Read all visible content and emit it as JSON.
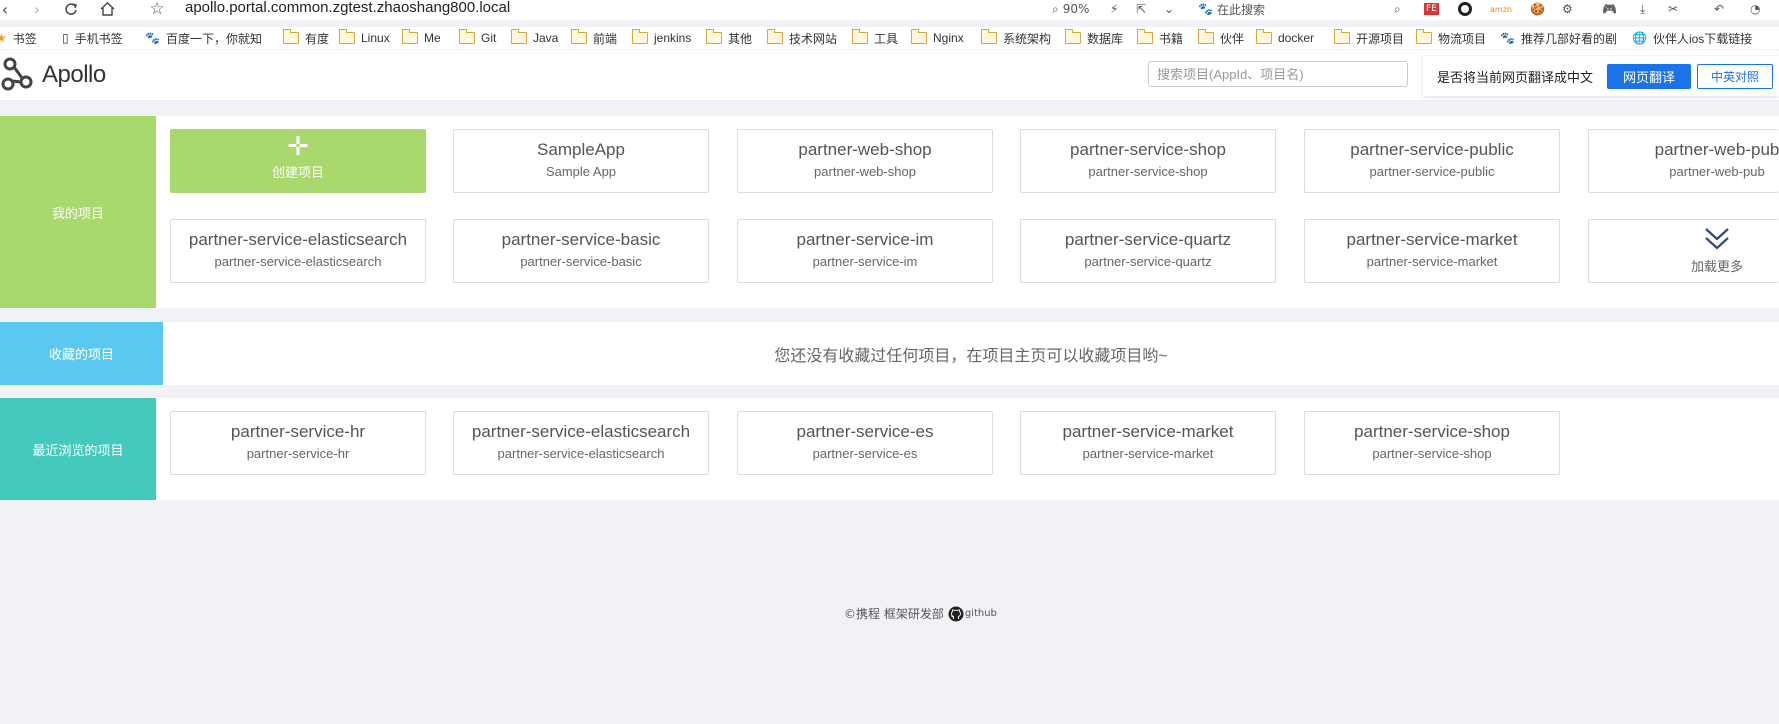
{
  "browser": {
    "url": "apollo.portal.common.zgtest.zhaoshang800.local",
    "zoom": "90%",
    "search_label": "在此搜索",
    "bookmarks": [
      {
        "label": "书签",
        "icon": "star-icon"
      },
      {
        "label": "手机书签",
        "icon": "phone-icon"
      },
      {
        "label": "百度一下，你就知",
        "icon": "baidu-icon"
      },
      {
        "label": "有度",
        "icon": "folder-icon"
      },
      {
        "label": "Linux",
        "icon": "folder-icon"
      },
      {
        "label": "Me",
        "icon": "folder-icon"
      },
      {
        "label": "Git",
        "icon": "folder-icon"
      },
      {
        "label": "Java",
        "icon": "folder-icon"
      },
      {
        "label": "前端",
        "icon": "folder-icon"
      },
      {
        "label": "jenkins",
        "icon": "folder-icon"
      },
      {
        "label": "其他",
        "icon": "folder-icon"
      },
      {
        "label": "技术网站",
        "icon": "folder-icon"
      },
      {
        "label": "工具",
        "icon": "folder-icon"
      },
      {
        "label": "Nginx",
        "icon": "folder-icon"
      },
      {
        "label": "系统架构",
        "icon": "folder-icon"
      },
      {
        "label": "数据库",
        "icon": "folder-icon"
      },
      {
        "label": "书籍",
        "icon": "folder-icon"
      },
      {
        "label": "伙伴",
        "icon": "folder-icon"
      },
      {
        "label": "docker",
        "icon": "folder-icon"
      },
      {
        "label": "开源项目",
        "icon": "folder-icon"
      },
      {
        "label": "物流项目",
        "icon": "folder-icon"
      },
      {
        "label": "推荐几部好看的剧",
        "icon": "paw-icon"
      },
      {
        "label": "伙伴人ios下载链接",
        "icon": "globe-icon"
      }
    ]
  },
  "header": {
    "logo_text": "Apollo",
    "search_placeholder": "搜索项目(AppId、项目名)"
  },
  "translate_bar": {
    "prompt": "是否将当前网页翻译成中文",
    "translate_button": "网页翻译",
    "compare_button": "中英对照"
  },
  "my_projects": {
    "label": "我的项目",
    "create_label": "创建项目",
    "more_label": "加载更多",
    "items": [
      {
        "name": "SampleApp",
        "id": "Sample App"
      },
      {
        "name": "partner-web-shop",
        "id": "partner-web-shop"
      },
      {
        "name": "partner-service-shop",
        "id": "partner-service-shop"
      },
      {
        "name": "partner-service-public",
        "id": "partner-service-public"
      },
      {
        "name": "partner-web-pub",
        "id": "partner-web-pub"
      },
      {
        "name": "partner-service-elasticsearch",
        "id": "partner-service-elasticsearch"
      },
      {
        "name": "partner-service-basic",
        "id": "partner-service-basic"
      },
      {
        "name": "partner-service-im",
        "id": "partner-service-im"
      },
      {
        "name": "partner-service-quartz",
        "id": "partner-service-quartz"
      },
      {
        "name": "partner-service-market",
        "id": "partner-service-market"
      }
    ]
  },
  "favorites": {
    "label": "收藏的项目",
    "empty_message": "您还没有收藏过任何项目，在项目主页可以收藏项目哟~"
  },
  "recent": {
    "label": "最近浏览的项目",
    "items": [
      {
        "name": "partner-service-hr",
        "id": "partner-service-hr"
      },
      {
        "name": "partner-service-elasticsearch",
        "id": "partner-service-elasticsearch"
      },
      {
        "name": "partner-service-es",
        "id": "partner-service-es"
      },
      {
        "name": "partner-service-market",
        "id": "partner-service-market"
      },
      {
        "name": "partner-service-shop",
        "id": "partner-service-shop"
      }
    ]
  },
  "footer": {
    "copyright": "©携程 框架研发部",
    "github": "github"
  },
  "colors": {
    "my_projects": "#a9d96c",
    "favorites": "#5bc8f2",
    "recent": "#43cabd",
    "translate_blue": "#1a73e8"
  }
}
